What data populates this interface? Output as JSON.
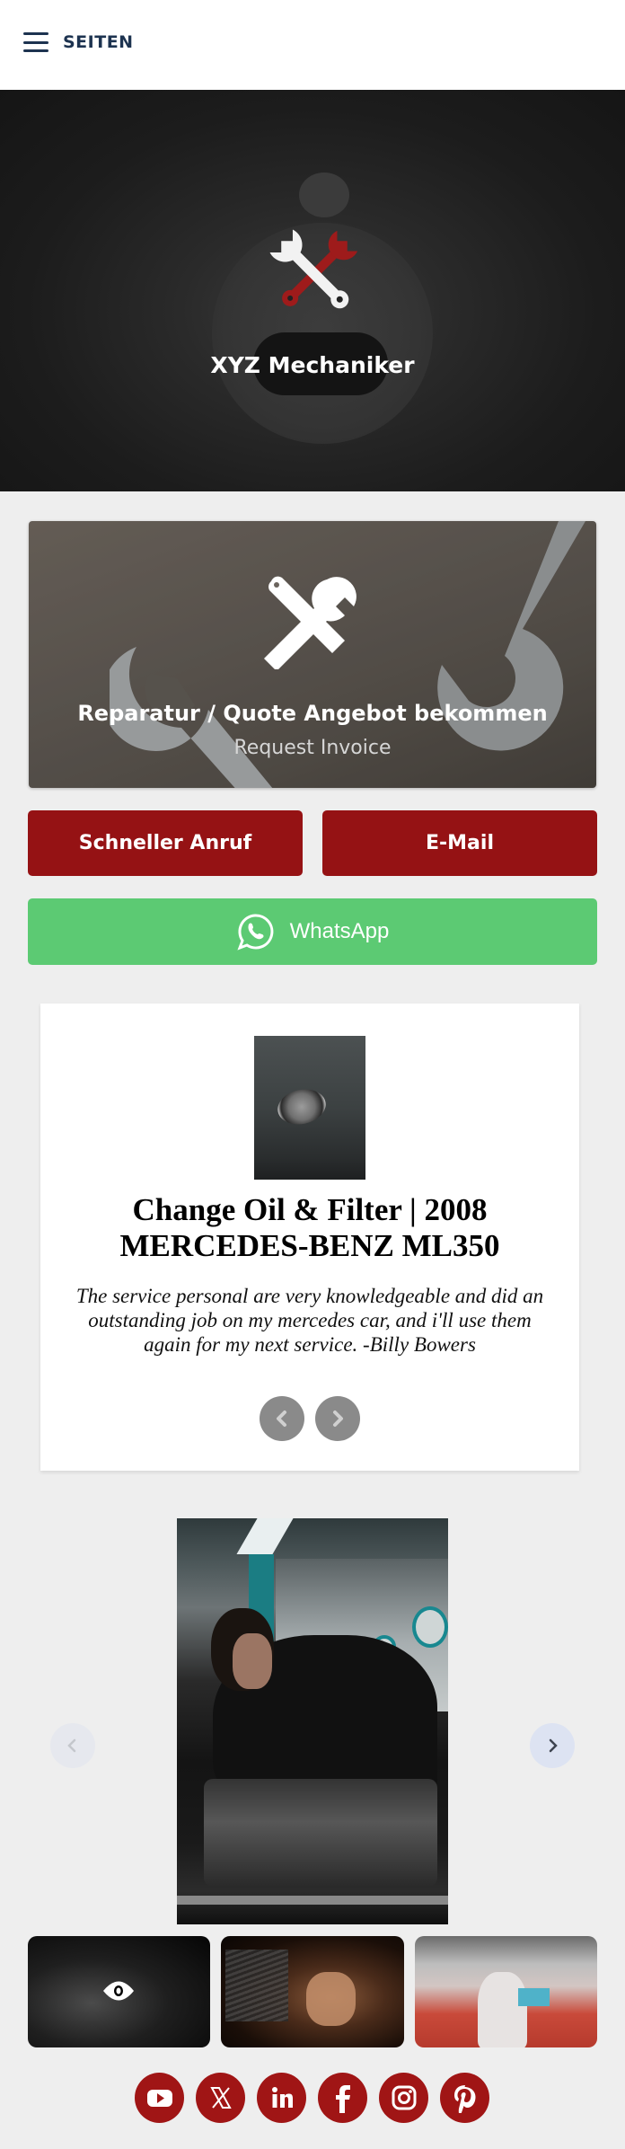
{
  "header": {
    "menu_label": "SEITEN",
    "menu_icon": "hamburger-icon"
  },
  "hero": {
    "title": "XYZ Mechaniker",
    "logo_icon": "crossed-wrenches-icon",
    "colors": {
      "accent": "#9e1b1b",
      "logo_light": "#f2f2f2"
    }
  },
  "quote_card": {
    "icon": "tools-icon",
    "title": "Reparatur / Quote Angebot bekommen",
    "subtitle": "Request Invoice"
  },
  "actions": {
    "call_label": "Schneller Anruf",
    "email_label": "E-Mail",
    "whatsapp_label": "WhatsApp",
    "colors": {
      "primary": "#951214",
      "whatsapp": "#5cca73"
    }
  },
  "testimonial": {
    "title": "Change Oil & Filter | 2008 MERCEDES-BENZ ML350",
    "body": "The service personal are very knowledgeable and did an outstanding job on my mercedes car, and i'll use them again for my next service. -Billy Bowers",
    "prev_icon": "chevron-left-icon",
    "next_icon": "chevron-right-icon"
  },
  "gallery": {
    "prev_icon": "chevron-left-icon",
    "next_icon": "chevron-right-icon",
    "thumbnails": [
      {
        "name": "mechanic-engine",
        "overlay_icon": "eye-icon"
      },
      {
        "name": "hand-wrench"
      },
      {
        "name": "car-lift-underside"
      }
    ]
  },
  "social": {
    "links": [
      {
        "name": "youtube",
        "icon": "youtube-icon"
      },
      {
        "name": "x",
        "icon": "x-icon"
      },
      {
        "name": "linkedin",
        "icon": "linkedin-icon"
      },
      {
        "name": "facebook",
        "icon": "facebook-icon"
      },
      {
        "name": "instagram",
        "icon": "instagram-icon"
      },
      {
        "name": "pinterest",
        "icon": "pinterest-icon"
      }
    ],
    "color": "#a01515"
  }
}
